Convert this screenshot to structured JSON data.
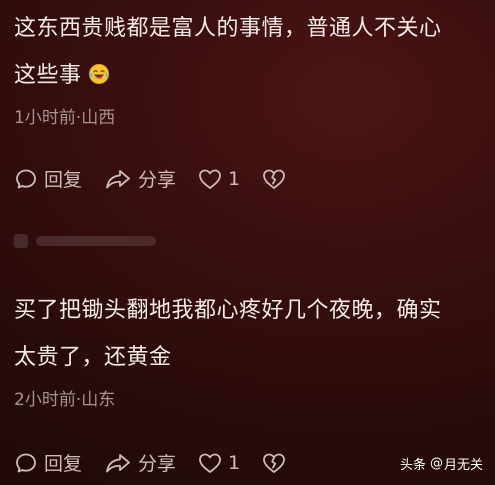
{
  "comments": [
    {
      "line1": "这东西贵贱都是富人的事情，普通人不关心",
      "line2": "这些事",
      "emoji": "laughing-crying-emoji",
      "meta": "1小时前·山西",
      "actions": {
        "reply_label": "回复",
        "share_label": "分享",
        "like_count": "1"
      }
    },
    {
      "line1": "买了把锄头翻地我都心疼好几个夜晚，确实",
      "line2": "太贵了，还黄金",
      "meta": "2小时前·山东",
      "actions": {
        "reply_label": "回复",
        "share_label": "分享",
        "like_count": "1"
      }
    }
  ],
  "watermark": {
    "brand": "头条",
    "at": "@",
    "author": "月无关"
  },
  "colors": {
    "background": "#3a0f0e",
    "text": "#f3ebea",
    "meta": "#a79391",
    "icon": "#cdbcba"
  }
}
